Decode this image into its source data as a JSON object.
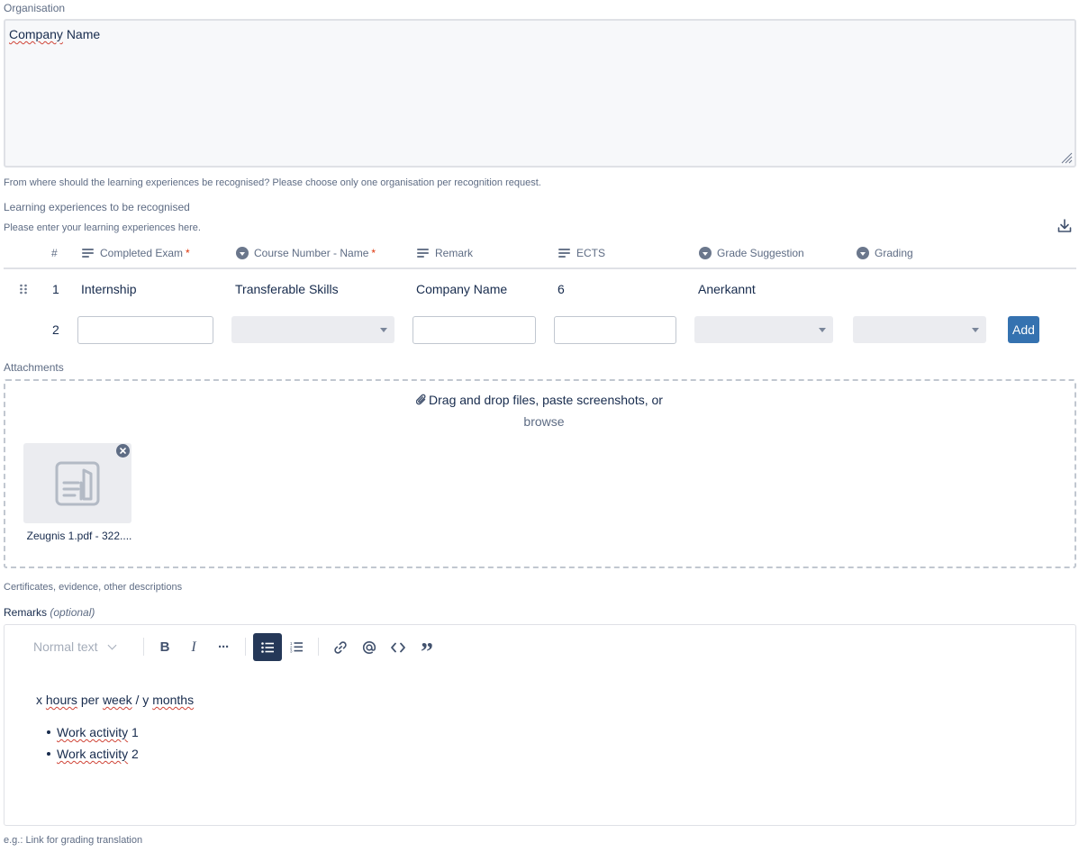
{
  "organisation": {
    "label": "Organisation",
    "value_word1": "Company",
    "value_word2": "Name",
    "help": "From where should the learning experiences be recognised? Please choose only one organisation per recognition request."
  },
  "learning": {
    "label": "Learning experiences to be recognised",
    "help": "Please enter your learning experiences here.",
    "columns": {
      "index": "#",
      "completed_exam": "Completed Exam",
      "course_number": "Course Number - Name",
      "remark": "Remark",
      "ects": "ECTS",
      "grade_suggestion": "Grade Suggestion",
      "grading": "Grading"
    },
    "required_mark": "*",
    "rows": [
      {
        "index": "1",
        "completed_exam": "Internship",
        "course_number": "Transferable Skills",
        "remark": "Company Name",
        "ects": "6",
        "grade_suggestion": "Anerkannt",
        "grading": ""
      }
    ],
    "new_row_index": "2",
    "add_label": "Add"
  },
  "attachments": {
    "label": "Attachments",
    "drop_text": "Drag and drop files, paste screenshots, or",
    "browse": "browse",
    "files": [
      {
        "name": "Zeugnis 1.pdf - 322...."
      }
    ],
    "help": "Certificates, evidence, other descriptions"
  },
  "remarks": {
    "label": "Remarks",
    "optional": "(optional)",
    "toolbar": {
      "text_style": "Normal text",
      "bold": "B",
      "italic": "I",
      "more": "···",
      "quote": "”"
    },
    "content": {
      "line_prefix": "x",
      "line_w1": "hours",
      "line_w2": "per",
      "line_w3": "week",
      "line_mid": "/ y",
      "line_w4": "months",
      "bullets": [
        {
          "word": "Work activity",
          "num": "1"
        },
        {
          "word": "Work activity",
          "num": "2"
        }
      ]
    },
    "help": "e.g.: Link for grading translation"
  }
}
